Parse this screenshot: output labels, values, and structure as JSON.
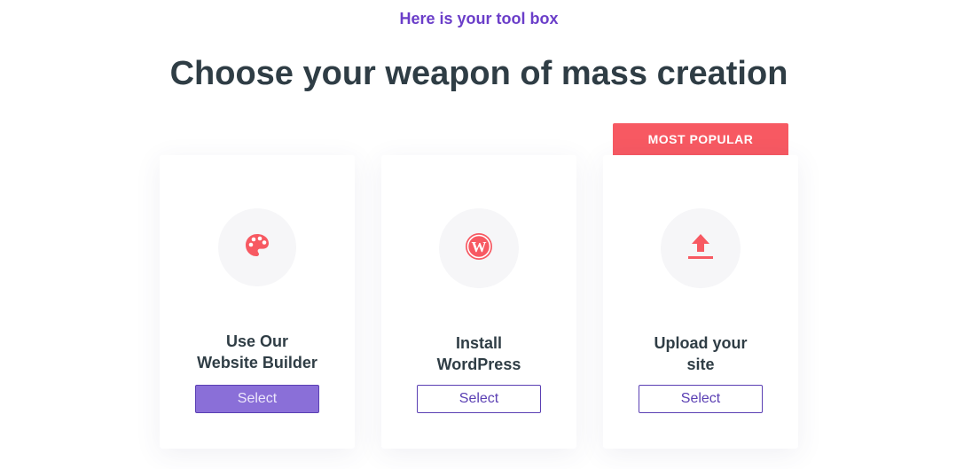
{
  "header": {
    "eyebrow": "Here is your tool box",
    "title": "Choose your weapon of mass creation"
  },
  "badge": {
    "label": "MOST POPULAR"
  },
  "colors": {
    "accent_purple": "#6b3ec9",
    "badge_red": "#f75962",
    "icon_red": "#f75962",
    "selected_button": "#8a6fd8"
  },
  "cards": [
    {
      "icon": "palette-icon",
      "title_line1": "Use Our",
      "title_line2": "Website Builder",
      "button_label": "Select",
      "selected": true
    },
    {
      "icon": "wordpress-icon",
      "title_line1": "Install",
      "title_line2": "WordPress",
      "button_label": "Select",
      "selected": false
    },
    {
      "icon": "upload-icon",
      "title_line1": "Upload your",
      "title_line2": "site",
      "button_label": "Select",
      "selected": false
    }
  ]
}
